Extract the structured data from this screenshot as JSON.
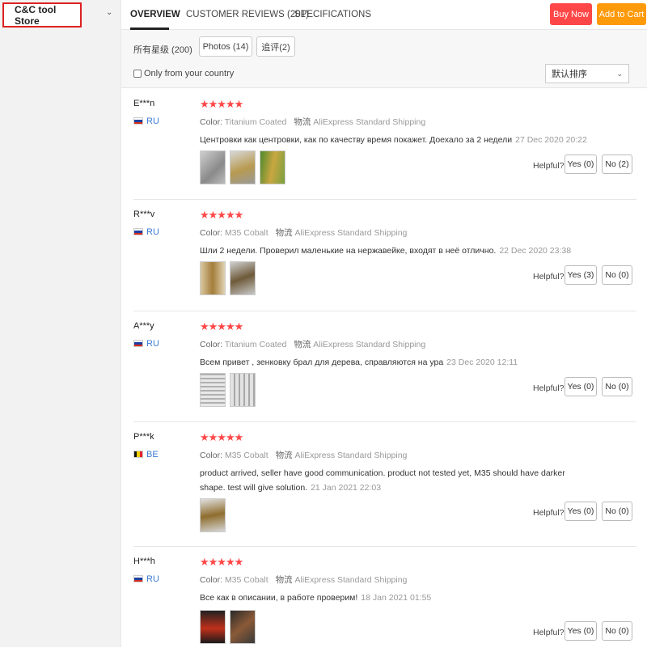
{
  "store": {
    "name": "C&C tool Store"
  },
  "nav": {
    "tabs": [
      {
        "label": "OVERVIEW",
        "active": true
      },
      {
        "label": "CUSTOMER REVIEWS (201)",
        "active": false
      },
      {
        "label": "SPECIFICATIONS",
        "active": false
      }
    ],
    "buy_now": "Buy Now",
    "add_to_cart": "Add to Cart"
  },
  "filters": {
    "rating_filter": "所有星级 (200)",
    "photos": "Photos (14)",
    "additional": "追评(2)",
    "only_country": "Only from your country",
    "sort": "默认排序"
  },
  "colors": {
    "accent_red": "#ff4747",
    "accent_orange": "#ff9a0a",
    "country_blue": "#3a7bd5"
  },
  "reviews": [
    {
      "name": "E***n",
      "country": "RU",
      "flag": "ru",
      "stars": "★★★★★",
      "color_label": "Color:",
      "color_value": "Titanium Coated",
      "shipping_label": "物流",
      "shipping_value": "AliExpress Standard Shipping",
      "text": "Центровки как центровки, как по качеству время покажет. Доехало за 2 недели",
      "date": "27 Dec 2020 20:22",
      "helpful": "Helpful?",
      "yes": "Yes (0)",
      "no": "No (2)"
    },
    {
      "name": "R***v",
      "country": "RU",
      "flag": "ru",
      "stars": "★★★★★",
      "color_label": "Color:",
      "color_value": "M35 Cobalt",
      "shipping_label": "物流",
      "shipping_value": "AliExpress Standard Shipping",
      "text": "Шли 2 недели. Проверил маленькие на нержавейке, входят в неё отлично.",
      "date": "22 Dec 2020 23:38",
      "helpful": "Helpful?",
      "yes": "Yes (3)",
      "no": "No (0)"
    },
    {
      "name": "A***y",
      "country": "RU",
      "flag": "ru",
      "stars": "★★★★★",
      "color_label": "Color:",
      "color_value": "Titanium Coated",
      "shipping_label": "物流",
      "shipping_value": "AliExpress Standard Shipping",
      "text": "Всем привет , зенковку брал для дерева, справляются на ура",
      "date": "23 Dec 2020 12:11",
      "helpful": "Helpful?",
      "yes": "Yes (0)",
      "no": "No (0)"
    },
    {
      "name": "P***k",
      "country": "BE",
      "flag": "be",
      "stars": "★★★★★",
      "color_label": "Color:",
      "color_value": "M35 Cobalt",
      "shipping_label": "物流",
      "shipping_value": "AliExpress Standard Shipping",
      "text": "product arrived, seller have good communication. product not tested yet, M35 should have darker shape. test will give solution.",
      "date": "21 Jan 2021 22:03",
      "helpful": "Helpful?",
      "yes": "Yes (0)",
      "no": "No (0)"
    },
    {
      "name": "H***h",
      "country": "RU",
      "flag": "ru",
      "stars": "★★★★★",
      "color_label": "Color:",
      "color_value": "M35 Cobalt",
      "shipping_label": "物流",
      "shipping_value": "AliExpress Standard Shipping",
      "text": "Все как в описании, в работе проверим!",
      "date": "18 Jan 2021 01:55",
      "helpful": "Helpful?",
      "yes": "Yes (0)",
      "no": "No (0)"
    }
  ]
}
